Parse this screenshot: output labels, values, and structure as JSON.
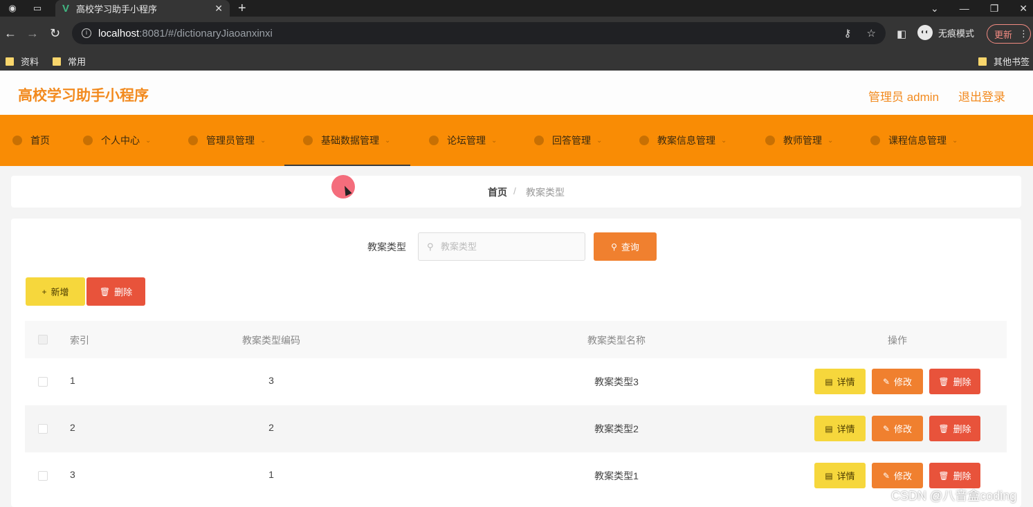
{
  "browser": {
    "tab_title": "高校学习助手小程序",
    "url_host": "localhost",
    "url_path": ":8081/#/dictionaryJiaoanxinxi",
    "incognito_label": "无痕模式",
    "update_label": "更新",
    "bookmarks": [
      "资料",
      "常用"
    ],
    "other_bookmarks": "其他书签"
  },
  "header": {
    "title": "高校学习助手小程序",
    "admin": "管理员 admin",
    "logout": "退出登录"
  },
  "nav": {
    "items": [
      {
        "label": "首页",
        "icon": "home-icon"
      },
      {
        "label": "个人中心",
        "icon": "user-icon"
      },
      {
        "label": "管理员管理",
        "icon": "admin-icon"
      },
      {
        "label": "基础数据管理",
        "icon": "send-icon"
      },
      {
        "label": "论坛管理",
        "icon": "forum-icon"
      },
      {
        "label": "回答管理",
        "icon": "chat-icon"
      },
      {
        "label": "教案信息管理",
        "icon": "user-icon"
      },
      {
        "label": "教师管理",
        "icon": "teacher-icon"
      },
      {
        "label": "课程信息管理",
        "icon": "course-icon"
      }
    ]
  },
  "breadcrumb": {
    "home": "首页",
    "separator": "/",
    "current": "教案类型"
  },
  "search": {
    "label": "教案类型",
    "placeholder": "教案类型",
    "button": "查询"
  },
  "actions": {
    "add": "新增",
    "delete": "删除"
  },
  "table": {
    "headers": {
      "index": "索引",
      "code": "教案类型编码",
      "name": "教案类型名称",
      "ops": "操作"
    },
    "rows": [
      {
        "index": "1",
        "code": "3",
        "name": "教案类型3"
      },
      {
        "index": "2",
        "code": "2",
        "name": "教案类型2"
      },
      {
        "index": "3",
        "code": "1",
        "name": "教案类型1"
      }
    ],
    "op_labels": {
      "detail": "详情",
      "edit": "修改",
      "delete": "删除"
    }
  },
  "watermark": "CSDN @八音盒coding",
  "colors": {
    "accent": "#f98c05",
    "title": "#f28a1e",
    "yellow": "#f6d73c",
    "orange": "#f0802f",
    "red": "#e8533b"
  }
}
